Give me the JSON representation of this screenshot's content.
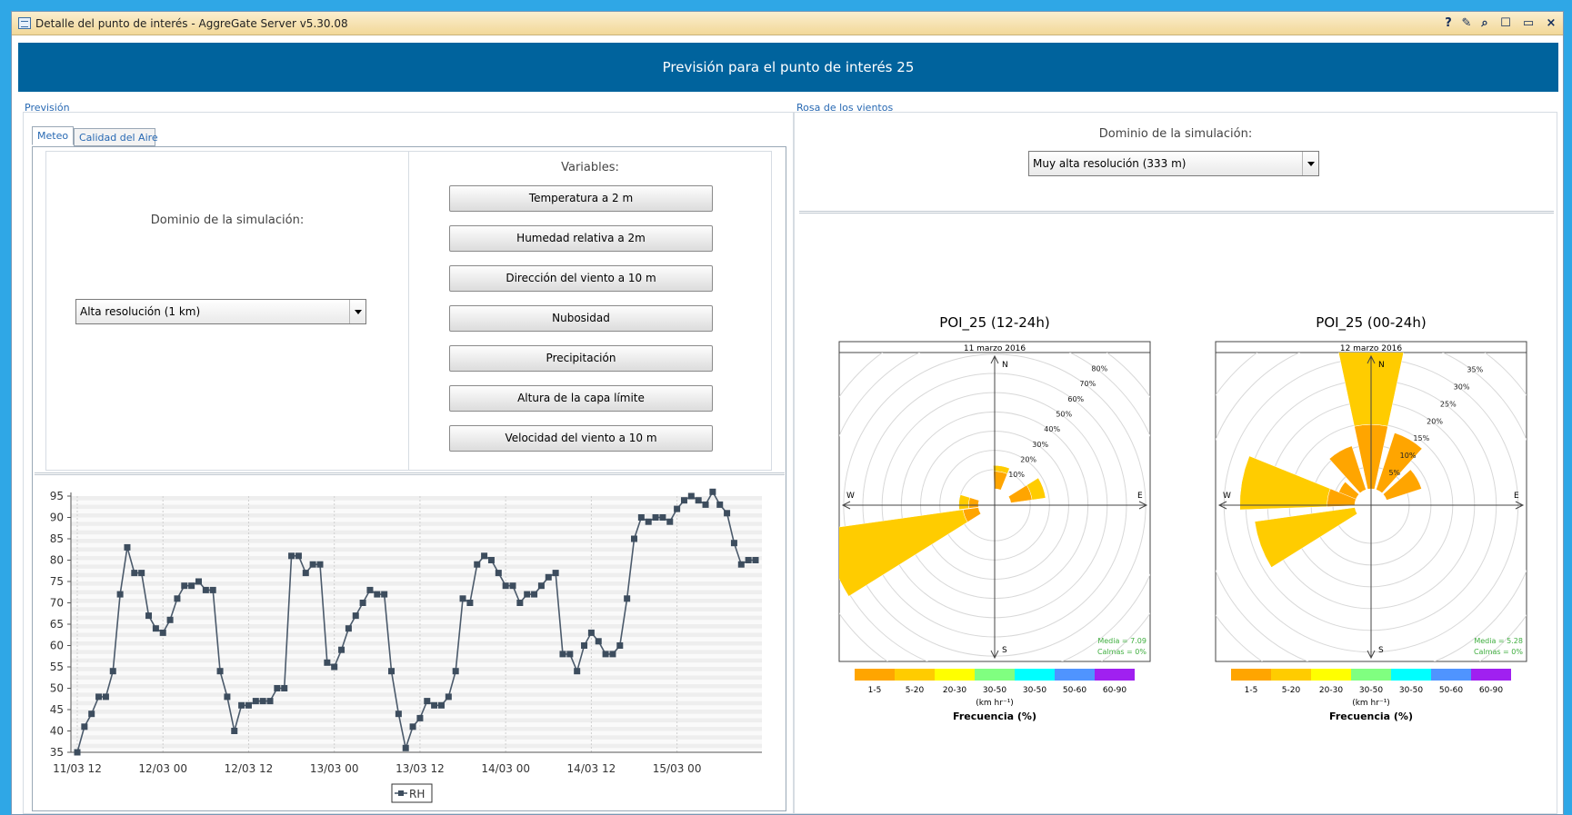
{
  "window": {
    "title": "Detalle del punto de interés - AggreGate Server v5.30.08",
    "controls": [
      "?",
      "✎",
      "⌕",
      "☐",
      "▭",
      "×"
    ]
  },
  "header": {
    "title": "Previsión para el punto de interés 25"
  },
  "left": {
    "section_label": "Previsión",
    "tabs": [
      {
        "label": "Meteo"
      },
      {
        "label": "Calidad del Aire"
      }
    ],
    "domain_label": "Dominio de la simulación:",
    "domain_select": "Alta resolución (1 km)",
    "variables_label": "Variables:",
    "variables": [
      "Temperatura a 2 m",
      "Humedad relativa a 2m",
      "Dirección del viento a 10 m",
      "Nubosidad",
      "Precipitación",
      "Altura de la capa límite",
      "Velocidad del viento a 10 m"
    ]
  },
  "right": {
    "section_label": "Rosa de los vientos",
    "domain_label": "Dominio de la simulación:",
    "domain_select": "Muy alta resolución (333 m)"
  },
  "chart_data": [
    {
      "type": "line",
      "ylim": [
        35,
        95
      ],
      "yticks": [
        35,
        40,
        45,
        50,
        55,
        60,
        65,
        70,
        75,
        80,
        85,
        90,
        95
      ],
      "xticks": [
        "11/03 12",
        "12/03 00",
        "12/03 12",
        "13/03 00",
        "13/03 12",
        "14/03 00",
        "14/03 12",
        "15/03 00"
      ],
      "grid": true,
      "legend_position": "bottom",
      "series": [
        {
          "name": "RH",
          "color": "#4b5a6b",
          "values": [
            35,
            41,
            44,
            48,
            48,
            54,
            72,
            83,
            77,
            77,
            67,
            64,
            63,
            66,
            71,
            74,
            74,
            75,
            73,
            73,
            54,
            48,
            40,
            46,
            46,
            47,
            47,
            47,
            50,
            50,
            81,
            81,
            77,
            79,
            79,
            56,
            55,
            59,
            64,
            67,
            70,
            73,
            72,
            72,
            54,
            44,
            36,
            41,
            43,
            47,
            46,
            46,
            48,
            54,
            71,
            70,
            79,
            81,
            80,
            77,
            74,
            74,
            70,
            72,
            72,
            74,
            76,
            77,
            58,
            58,
            54,
            60,
            63,
            61,
            58,
            58,
            60,
            71,
            85,
            90,
            89,
            90,
            90,
            89,
            92,
            94,
            95,
            94,
            93,
            96,
            93,
            91,
            84,
            79,
            80,
            80
          ]
        }
      ]
    },
    {
      "type": "polar",
      "title": "POI_25 (12-24h)",
      "subtitle": "11 marzo 2016",
      "radial_ticks": [
        "10%",
        "20%",
        "30%",
        "40%",
        "50%",
        "60%",
        "70%",
        "80%"
      ],
      "directions": [
        "N",
        "E",
        "S",
        "W"
      ],
      "stats": [
        "Media = 7.09",
        "Calmas = 0%"
      ],
      "legend_title": "Frecuencia (%)",
      "legend_unit": "(km hr⁻¹)",
      "legend": [
        {
          "label": "1-5",
          "color": "#ffa500"
        },
        {
          "label": "5-20",
          "color": "#ffcc00"
        },
        {
          "label": "20-30",
          "color": "#ffff00"
        },
        {
          "label": "30-50",
          "color": "#80ff80"
        },
        {
          "label": "30-50",
          "color": "#00ffff"
        },
        {
          "label": "50-60",
          "color": "#4f94ff"
        },
        {
          "label": "60-90",
          "color": "#a020f0"
        }
      ],
      "bins": [
        {
          "direction_deg": 10,
          "segments": [
            {
              "color": "#ffa500",
              "value": 9
            },
            {
              "color": "#ffcc00",
              "value": 3
            }
          ]
        },
        {
          "direction_deg": 70,
          "segments": [
            {
              "color": "#ffa500",
              "value": 11
            },
            {
              "color": "#ffcc00",
              "value": 7
            }
          ]
        },
        {
          "direction_deg": 250,
          "segments": [
            {
              "color": "#ffa500",
              "value": 8
            },
            {
              "color": "#ffcc00",
              "value": 72
            }
          ]
        },
        {
          "direction_deg": 275,
          "segments": [
            {
              "color": "#ffa500",
              "value": 5
            },
            {
              "color": "#ffcc00",
              "value": 5
            }
          ]
        }
      ],
      "max": 85
    },
    {
      "type": "polar",
      "title": "POI_25 (00-24h)",
      "subtitle": "12 marzo 2016",
      "radial_ticks": [
        "5%",
        "10%",
        "15%",
        "20%",
        "25%",
        "30%",
        "35%"
      ],
      "directions": [
        "N",
        "E",
        "S",
        "W"
      ],
      "stats": [
        "Media = 5.28",
        "Calmas = 0%"
      ],
      "legend_title": "Frecuencia (%)",
      "legend_unit": "(km hr⁻¹)",
      "legend": [
        {
          "label": "1-5",
          "color": "#ffa500"
        },
        {
          "label": "5-20",
          "color": "#ffcc00"
        },
        {
          "label": "20-30",
          "color": "#ffff00"
        },
        {
          "label": "30-50",
          "color": "#80ff80"
        },
        {
          "label": "30-50",
          "color": "#00ffff"
        },
        {
          "label": "50-60",
          "color": "#4f94ff"
        },
        {
          "label": "60-90",
          "color": "#a020f0"
        }
      ],
      "bins": [
        {
          "direction_deg": 0,
          "segments": [
            {
              "color": "#ffa500",
              "value": 14
            },
            {
              "color": "#ffcc00",
              "value": 22
            }
          ]
        },
        {
          "direction_deg": 30,
          "segments": [
            {
              "color": "#ffa500",
              "value": 13
            }
          ]
        },
        {
          "direction_deg": 60,
          "segments": [
            {
              "color": "#ffa500",
              "value": 8
            }
          ]
        },
        {
          "direction_deg": 330,
          "segments": [
            {
              "color": "#ffa500",
              "value": 10
            }
          ]
        },
        {
          "direction_deg": 300,
          "segments": [
            {
              "color": "#ffa500",
              "value": 4
            }
          ]
        },
        {
          "direction_deg": 280,
          "segments": [
            {
              "color": "#ffa500",
              "value": 6
            },
            {
              "color": "#ffcc00",
              "value": 19
            }
          ]
        },
        {
          "direction_deg": 250,
          "segments": [
            {
              "color": "#ffcc00",
              "value": 22
            }
          ]
        }
      ],
      "max": 36
    }
  ]
}
